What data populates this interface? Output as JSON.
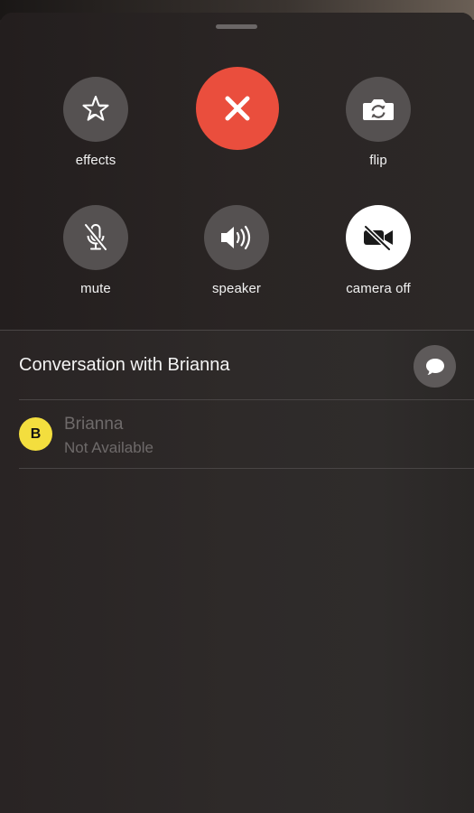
{
  "sheet": {
    "controls": {
      "effects": {
        "label": "effects",
        "icon": "star-effects-icon"
      },
      "end_call": {
        "icon": "close-icon",
        "color": "#ea4e3d"
      },
      "flip": {
        "label": "flip",
        "icon": "camera-flip-icon"
      },
      "mute": {
        "label": "mute",
        "icon": "mic-off-icon"
      },
      "speaker": {
        "label": "speaker",
        "icon": "speaker-icon"
      },
      "camera_off": {
        "label": "camera off",
        "icon": "video-off-icon"
      }
    },
    "conversation": {
      "title": "Conversation with Brianna",
      "message_icon": "message-bubble-icon"
    },
    "contacts": [
      {
        "initial": "B",
        "name": "Brianna",
        "status": "Not Available",
        "avatar_color": "#f3de3e"
      }
    ]
  }
}
